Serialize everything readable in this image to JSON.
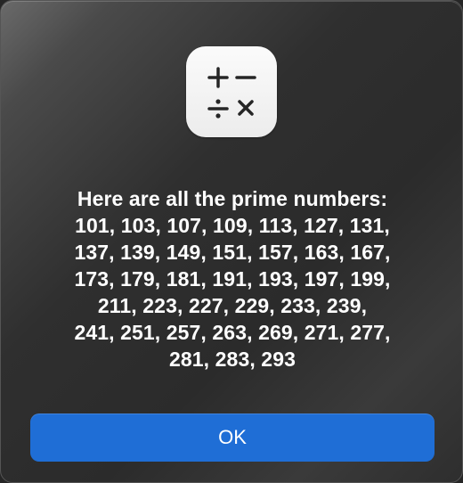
{
  "dialog": {
    "icon": "calculator-app-icon",
    "message_lines": [
      "Here are all the prime numbers:",
      "101, 103, 107, 109, 113, 127, 131,",
      "137, 139, 149, 151, 157, 163, 167,",
      "173, 179, 181, 191, 193, 197, 199,",
      "211, 223, 227, 229, 233, 239,",
      "241, 251, 257, 263, 269, 271, 277,",
      "281, 283, 293"
    ],
    "ok_label": "OK"
  },
  "colors": {
    "button": "#1f6ed6",
    "text": "#ffffff",
    "background": "#2b2b2b"
  }
}
